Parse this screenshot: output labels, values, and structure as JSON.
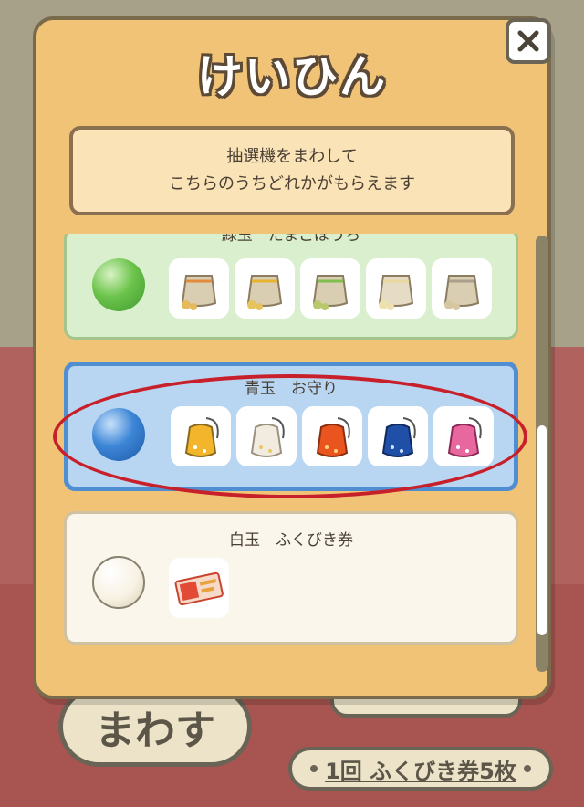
{
  "dialog": {
    "title": "けいひん",
    "notice_line1": "抽選機をまわして",
    "notice_line2": "こちらのうちどれかがもらえます"
  },
  "prizes": [
    {
      "title": "緑玉　たまごぼうろ",
      "ball_color": "#6cc44c",
      "item_icons": [
        "boro-bag-icon",
        "boro-bag-icon",
        "boro-bag-icon",
        "boro-bag-icon",
        "boro-bag-icon"
      ]
    },
    {
      "title": "青玉　お守り",
      "ball_color": "#3d86d6",
      "item_icons": [
        "omamori-yellow-icon",
        "omamori-white-icon",
        "omamori-orange-icon",
        "omamori-blue-icon",
        "omamori-pink-icon"
      ],
      "item_colors": [
        "#f2b52c",
        "#f1ecdf",
        "#e9541f",
        "#1f4fa6",
        "#e8679e"
      ]
    },
    {
      "title": "白玉　ふくびき券",
      "ball_color": "#f7f2e4",
      "item_icons": [
        "fukubiki-ticket-icon"
      ]
    }
  ],
  "controls": {
    "spin_label": "まわす",
    "cost_label": "1回 ふくびき券5枚"
  },
  "colors": {
    "panel": "#f0c376",
    "highlight_ring": "#c8202a"
  }
}
